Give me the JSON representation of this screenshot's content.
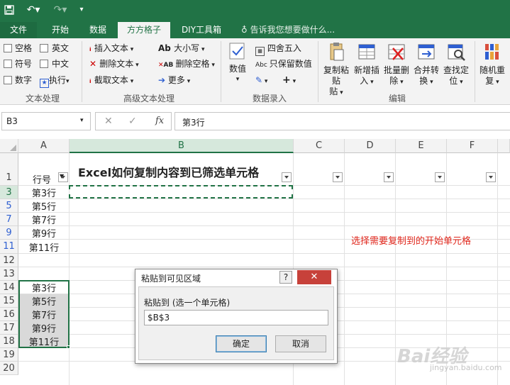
{
  "quick_access": {
    "save_icon": "save-icon",
    "undo_icon": "undo-icon",
    "redo_icon": "redo-icon"
  },
  "tabs": [
    {
      "label": "文件"
    },
    {
      "label": "开始"
    },
    {
      "label": "数据"
    },
    {
      "label": "方方格子"
    },
    {
      "label": "DIY工具箱"
    }
  ],
  "active_tab": "方方格子",
  "tell_me": "告诉我您想要做什么...",
  "ribbon": {
    "text_processing": {
      "checkboxes": [
        "空格",
        "英文",
        "符号",
        "中文",
        "数字"
      ],
      "execute": "执行",
      "group_label": "文本处理"
    },
    "advanced_text": {
      "buttons": [
        "插入文本",
        "删除文本",
        "截取文本",
        "大小写",
        "删除空格",
        "更多"
      ],
      "group_label": "高级文本处理"
    },
    "data_entry": {
      "value_button": "数值",
      "round": "四舍五入",
      "keep_value": "只保留数值",
      "group_label": "数据录入"
    },
    "edit": {
      "buttons": [
        {
          "label": "复制粘贴",
          "sub": "贴"
        },
        {
          "label": "新增插",
          "sub": "入"
        },
        {
          "label": "批量删",
          "sub": "除"
        },
        {
          "label": "合并转",
          "sub": "换"
        },
        {
          "label": "查找定",
          "sub": "位"
        },
        {
          "label": "随机重",
          "sub": "复"
        }
      ],
      "group_label": "编辑"
    }
  },
  "formula_bar": {
    "name_box": "B3",
    "cancel": "✕",
    "confirm": "✓",
    "fx": "fx",
    "content": "第3行"
  },
  "sheet": {
    "columns": [
      "A",
      "B",
      "C",
      "D",
      "E",
      "F"
    ],
    "rows": [
      "1",
      "3",
      "5",
      "7",
      "9",
      "11",
      "12",
      "13",
      "14",
      "15",
      "16",
      "17",
      "18",
      "19",
      "20"
    ],
    "header_a": "行号",
    "title": "Excel如何复制内容到已筛选单元格",
    "col_a_top": [
      "第3行",
      "第5行",
      "第7行",
      "第9行",
      "第11行"
    ],
    "col_a_bottom": [
      "第3行",
      "第5行",
      "第7行",
      "第9行",
      "第11行"
    ]
  },
  "annotation": "选择需要复制到的开始单元格",
  "dialog": {
    "title": "粘贴到可见区域",
    "help": "?",
    "close": "✕",
    "label": "粘贴到 (选一个单元格)",
    "value": "$B$3",
    "ok": "确定",
    "cancel": "取消"
  },
  "watermark": {
    "text": "Bai经验",
    "url": "jingyan.baidu.com"
  },
  "colors": {
    "excel_green": "#217346",
    "annotation_red": "#e0261b",
    "close_red": "#c7413a"
  }
}
